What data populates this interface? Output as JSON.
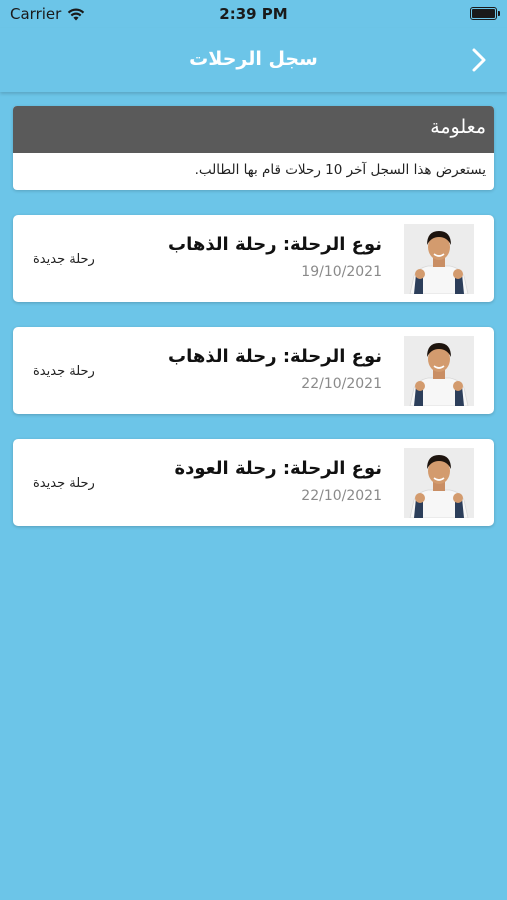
{
  "status_bar": {
    "carrier": "Carrier",
    "time": "2:39 PM",
    "wifi_icon": "wifi-icon",
    "battery_icon": "battery-icon"
  },
  "nav": {
    "title": "سجل الرحلات",
    "back_icon": "chevron-right-icon"
  },
  "info": {
    "title": "معلومة",
    "text": "يستعرض هذا السجل آخر 10 رحلات قام بها الطالب."
  },
  "trips": [
    {
      "title": "نوع الرحلة: رحلة الذهاب",
      "date": "19/10/2021",
      "status": "رحلة جديدة"
    },
    {
      "title": "نوع الرحلة: رحلة الذهاب",
      "date": "22/10/2021",
      "status": "رحلة جديدة"
    },
    {
      "title": "نوع الرحلة: رحلة العودة",
      "date": "22/10/2021",
      "status": "رحلة جديدة"
    }
  ],
  "colors": {
    "background": "#6cc5e8",
    "info_header": "#5a5a5a",
    "card": "#ffffff"
  }
}
